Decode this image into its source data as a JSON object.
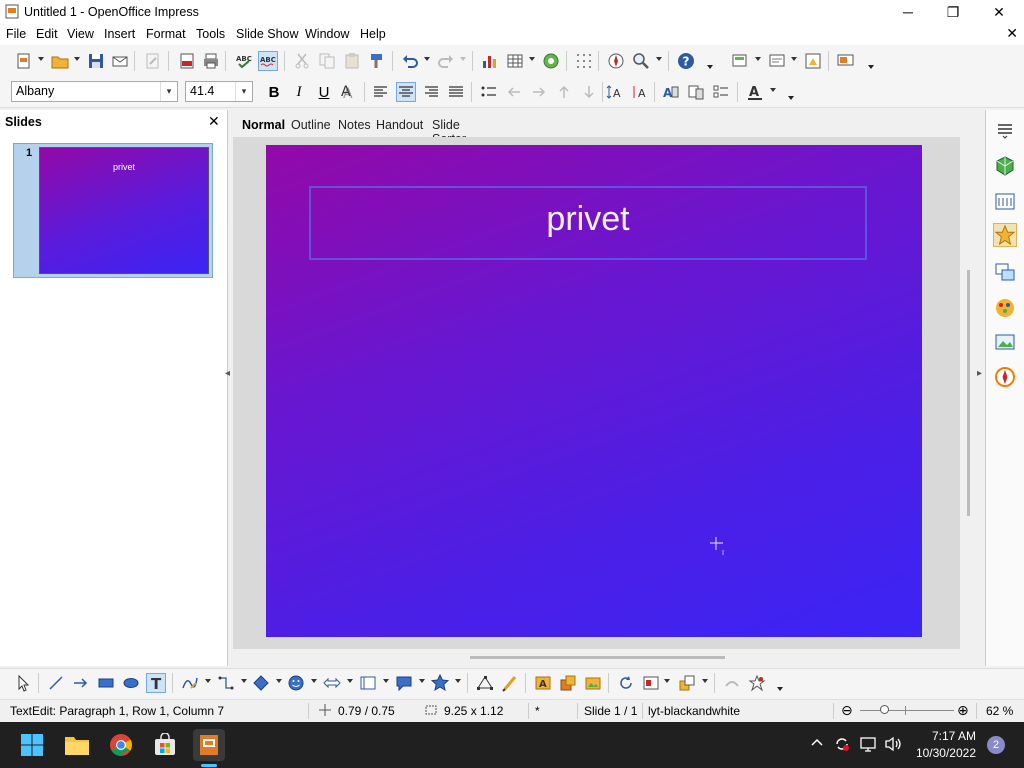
{
  "window": {
    "title": "Untitled 1 - OpenOffice Impress",
    "minimize_glyph": "─",
    "maximize_glyph": "❐",
    "close_glyph": "✕"
  },
  "menu": {
    "items": [
      "File",
      "Edit",
      "View",
      "Insert",
      "Format",
      "Tools",
      "Slide Show",
      "Window",
      "Help"
    ],
    "doc_close_glyph": "✕"
  },
  "formatting": {
    "font_name": "Albany",
    "font_size": "41.4",
    "bold": "B",
    "italic": "I",
    "underline": "U"
  },
  "slides_pane": {
    "title": "Slides",
    "close_glyph": "✕",
    "thumbnails": [
      {
        "number": "1",
        "title": "privet"
      }
    ]
  },
  "view_tabs": [
    "Normal",
    "Outline",
    "Notes",
    "Handout",
    "Slide Sorter"
  ],
  "active_view_tab": "Normal",
  "slide": {
    "title": "privet"
  },
  "status_bar": {
    "edit_status": "TextEdit: Paragraph 1, Row 1, Column 7",
    "position": "0.79 / 0.75",
    "size": "9.25 x 1.12",
    "modified": "*",
    "slide_indicator": "Slide 1 / 1",
    "layout_name": "lyt-blackandwhite",
    "zoom": "62 %"
  },
  "taskbar": {
    "time": "7:17 AM",
    "date": "10/30/2022",
    "notification_count": "2"
  },
  "colors": {
    "slide_gradient_start": "#9309a8",
    "slide_gradient_end": "#3b24f5",
    "taskbar": "#202020",
    "active_button": "#cde3f7"
  }
}
